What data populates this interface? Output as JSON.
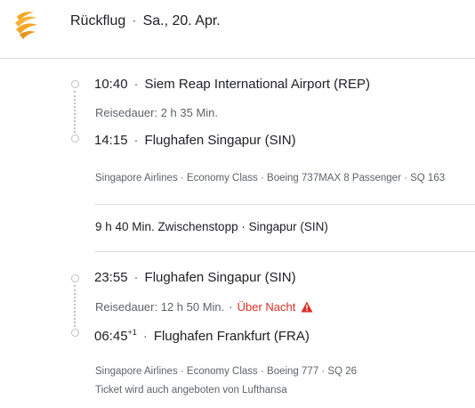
{
  "header": {
    "direction": "Rückflug",
    "date": "Sa., 20. Apr."
  },
  "segments": [
    {
      "dep_time": "10:40",
      "dep_airport": "Siem Reap International Airport (REP)",
      "duration": "Reisedauer: 2 h 35 Min.",
      "arr_time": "14:15",
      "arr_airport": "Flughafen Singapur (SIN)",
      "details": "Singapore Airlines · Economy Class · Boeing 737MAX 8 Passenger · SQ 163"
    },
    {
      "dep_time": "23:55",
      "dep_airport": "Flughafen Singapur (SIN)",
      "duration": "Reisedauer: 12 h 50 Min.",
      "overnight": "Über Nacht",
      "arr_time": "06:45",
      "arr_day_offset": "+1",
      "arr_airport": "Flughafen Frankfurt (FRA)",
      "details": "Singapore Airlines · Economy Class · Boeing 777 · SQ 26",
      "also_sold": "Ticket wird auch angeboten von Lufthansa"
    }
  ],
  "layover": "9 h 40 Min. Zwischenstopp · Singapur (SIN)",
  "colors": {
    "warning": "#d93025",
    "logo": "#f5a623",
    "divider": "#dadce0"
  },
  "icons": {
    "airline_logo": "singapore-airlines-logo",
    "warning": "warning-triangle-icon"
  }
}
